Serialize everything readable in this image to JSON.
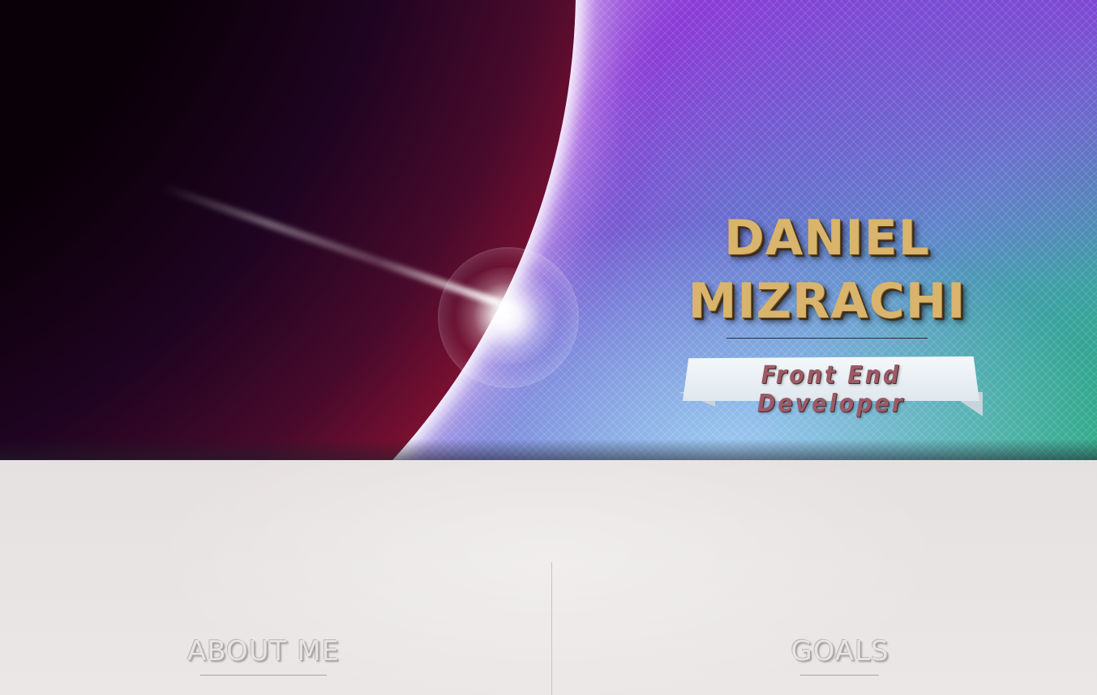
{
  "hero": {
    "name_first": "DANIEL",
    "name_last": "MIZRACHI",
    "subtitle": "Front End Developer"
  },
  "sections": {
    "about": {
      "title": "ABOUT ME"
    },
    "goals": {
      "title": "GOALS"
    }
  },
  "colors": {
    "name_gold": "#d8b46c",
    "subtitle_rose": "#9c5a66",
    "content_background": "#e8e4e4"
  }
}
